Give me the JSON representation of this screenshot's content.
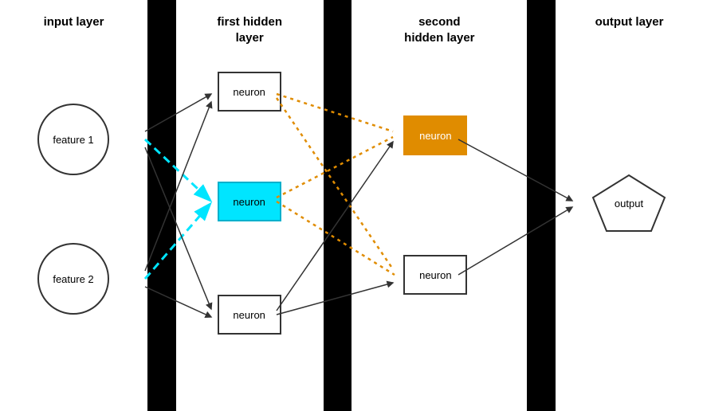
{
  "layers": [
    {
      "id": "input",
      "title": "input layer",
      "nodes": [
        {
          "label": "feature 1",
          "type": "circle"
        },
        {
          "label": "feature 2",
          "type": "circle"
        }
      ]
    },
    {
      "id": "first-hidden",
      "title": "first hidden\nlayer",
      "nodes": [
        {
          "label": "neuron",
          "type": "box"
        },
        {
          "label": "neuron",
          "type": "box-cyan"
        },
        {
          "label": "neuron",
          "type": "box"
        }
      ]
    },
    {
      "id": "second-hidden",
      "title": "second\nhidden layer",
      "nodes": [
        {
          "label": "neuron",
          "type": "box-orange"
        },
        {
          "label": "neuron",
          "type": "box"
        }
      ]
    },
    {
      "id": "output",
      "title": "output layer",
      "nodes": [
        {
          "label": "output",
          "type": "pentagon"
        }
      ]
    }
  ],
  "colors": {
    "cyan_dashed": "#00e5ff",
    "orange_dotted": "#e08c00",
    "black_arrow": "#333"
  }
}
